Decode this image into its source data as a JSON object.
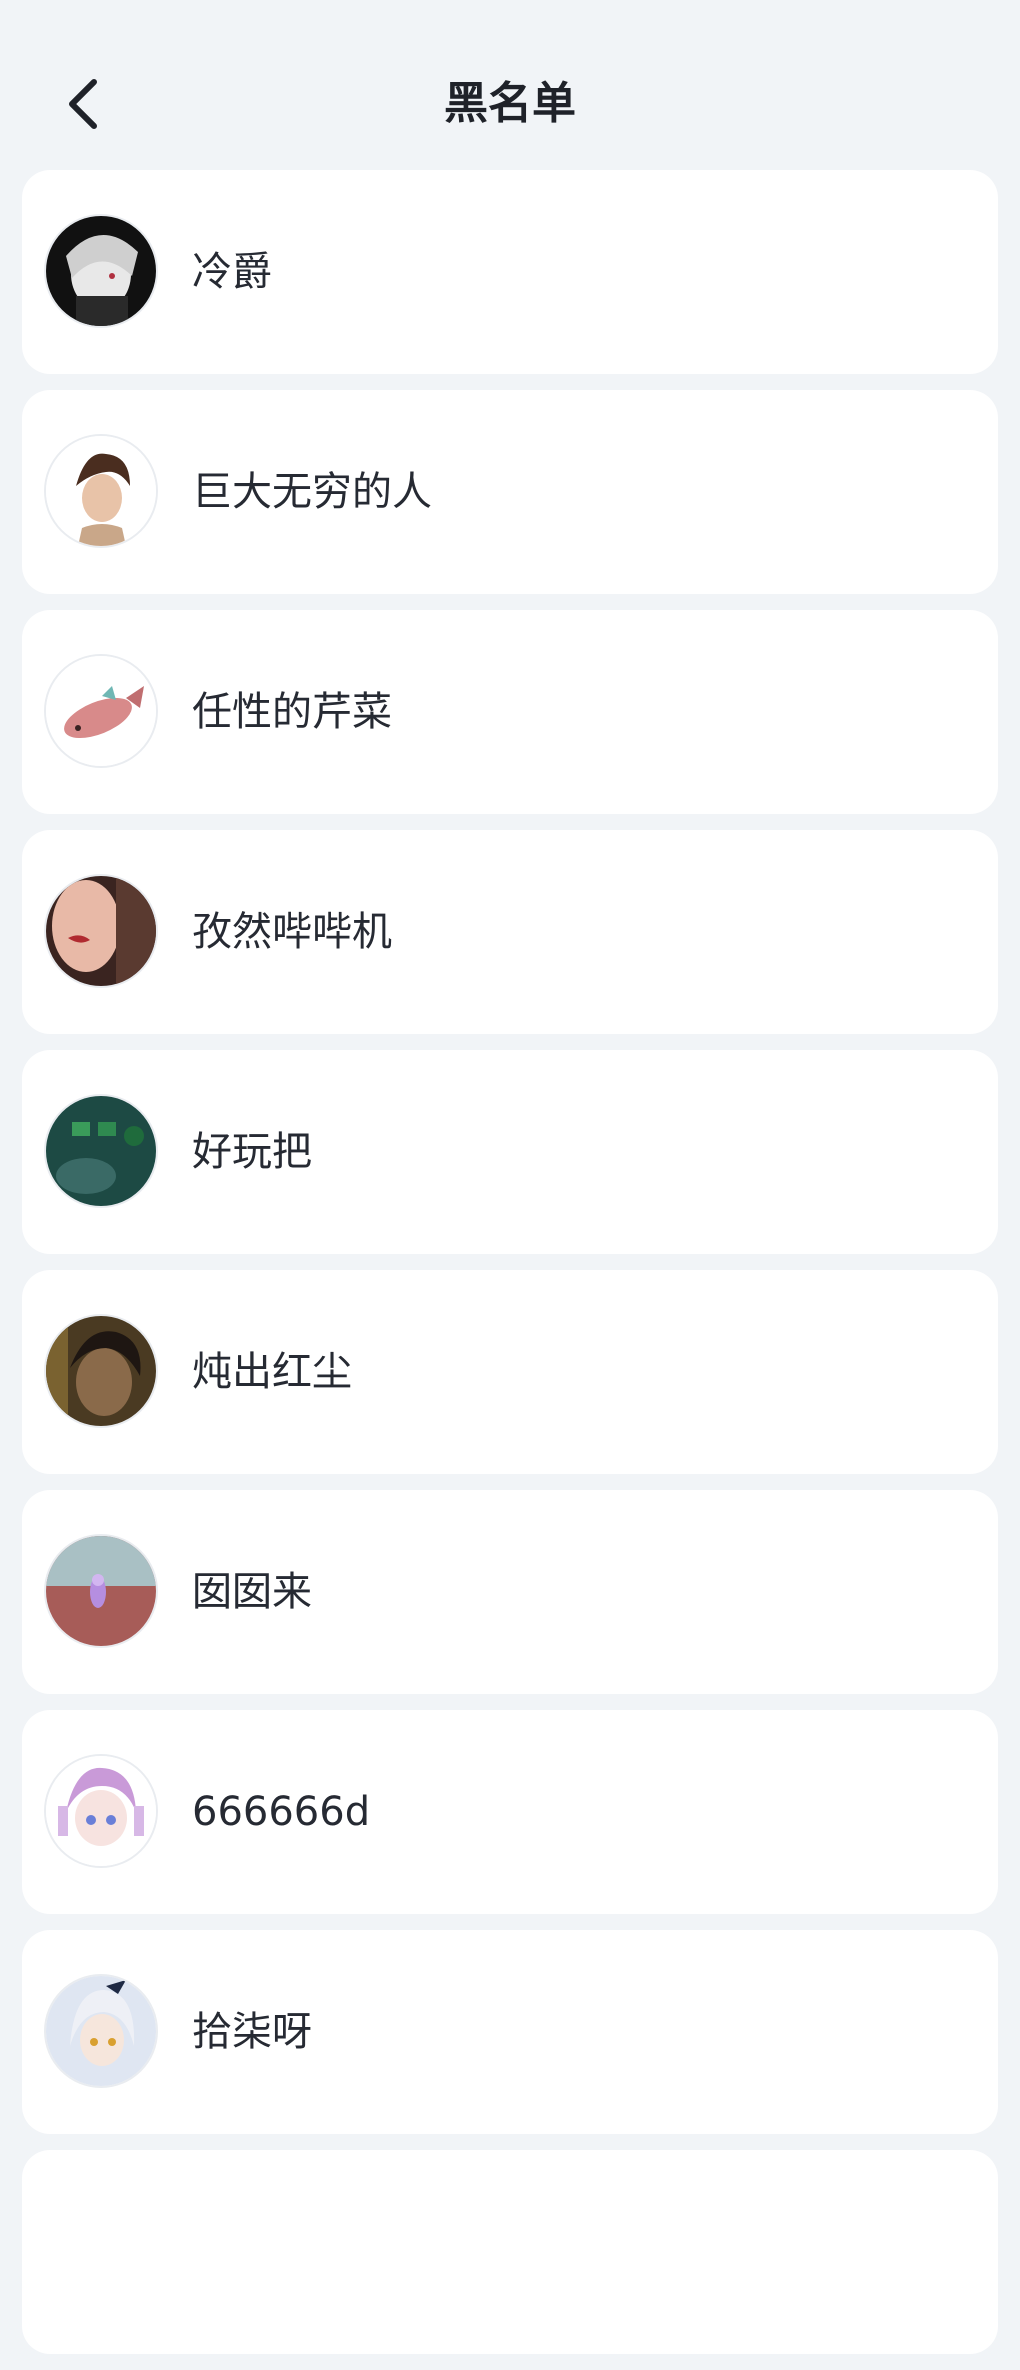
{
  "header": {
    "title": "黑名单",
    "back_icon": "chevron-left-icon"
  },
  "blacklist": [
    {
      "name": "冷爵"
    },
    {
      "name": "巨大无穷的人"
    },
    {
      "name": "任性的芹菜"
    },
    {
      "name": "孜然哔哔机"
    },
    {
      "name": "好玩把"
    },
    {
      "name": "炖出红尘"
    },
    {
      "name": "囡囡来"
    },
    {
      "name": "666666d"
    },
    {
      "name": "拾柒呀"
    }
  ],
  "colors": {
    "background": "#f1f4f7",
    "card": "#ffffff",
    "text": "#262a33"
  }
}
